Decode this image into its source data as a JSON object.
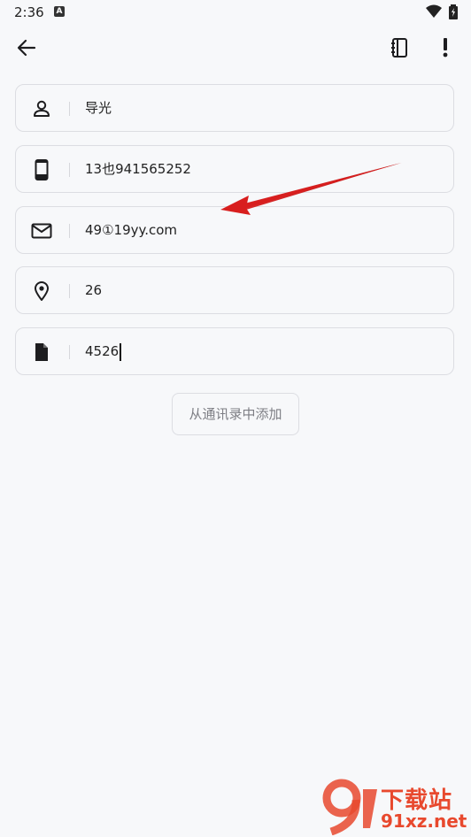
{
  "status_bar": {
    "time": "2:36",
    "keyboard_badge": "A"
  },
  "toolbar": {
    "back_icon": "arrow-left-icon",
    "contacts_icon": "contact-book-icon",
    "menu_icon": "exclamation-icon"
  },
  "fields": [
    {
      "icon": "person-icon",
      "value": "导光"
    },
    {
      "icon": "phone-icon",
      "value": "13也941565252"
    },
    {
      "icon": "mail-icon",
      "value": "49①19yy.com"
    },
    {
      "icon": "location-pin-icon",
      "value": "26"
    },
    {
      "icon": "document-icon",
      "value": "4526"
    }
  ],
  "add_from_contacts_label": "从通讯录中添加",
  "annotation": {
    "color": "#d81e1e"
  },
  "watermark": {
    "brand": "下载站",
    "domain": "91xz.net",
    "color": "#e8492e"
  }
}
